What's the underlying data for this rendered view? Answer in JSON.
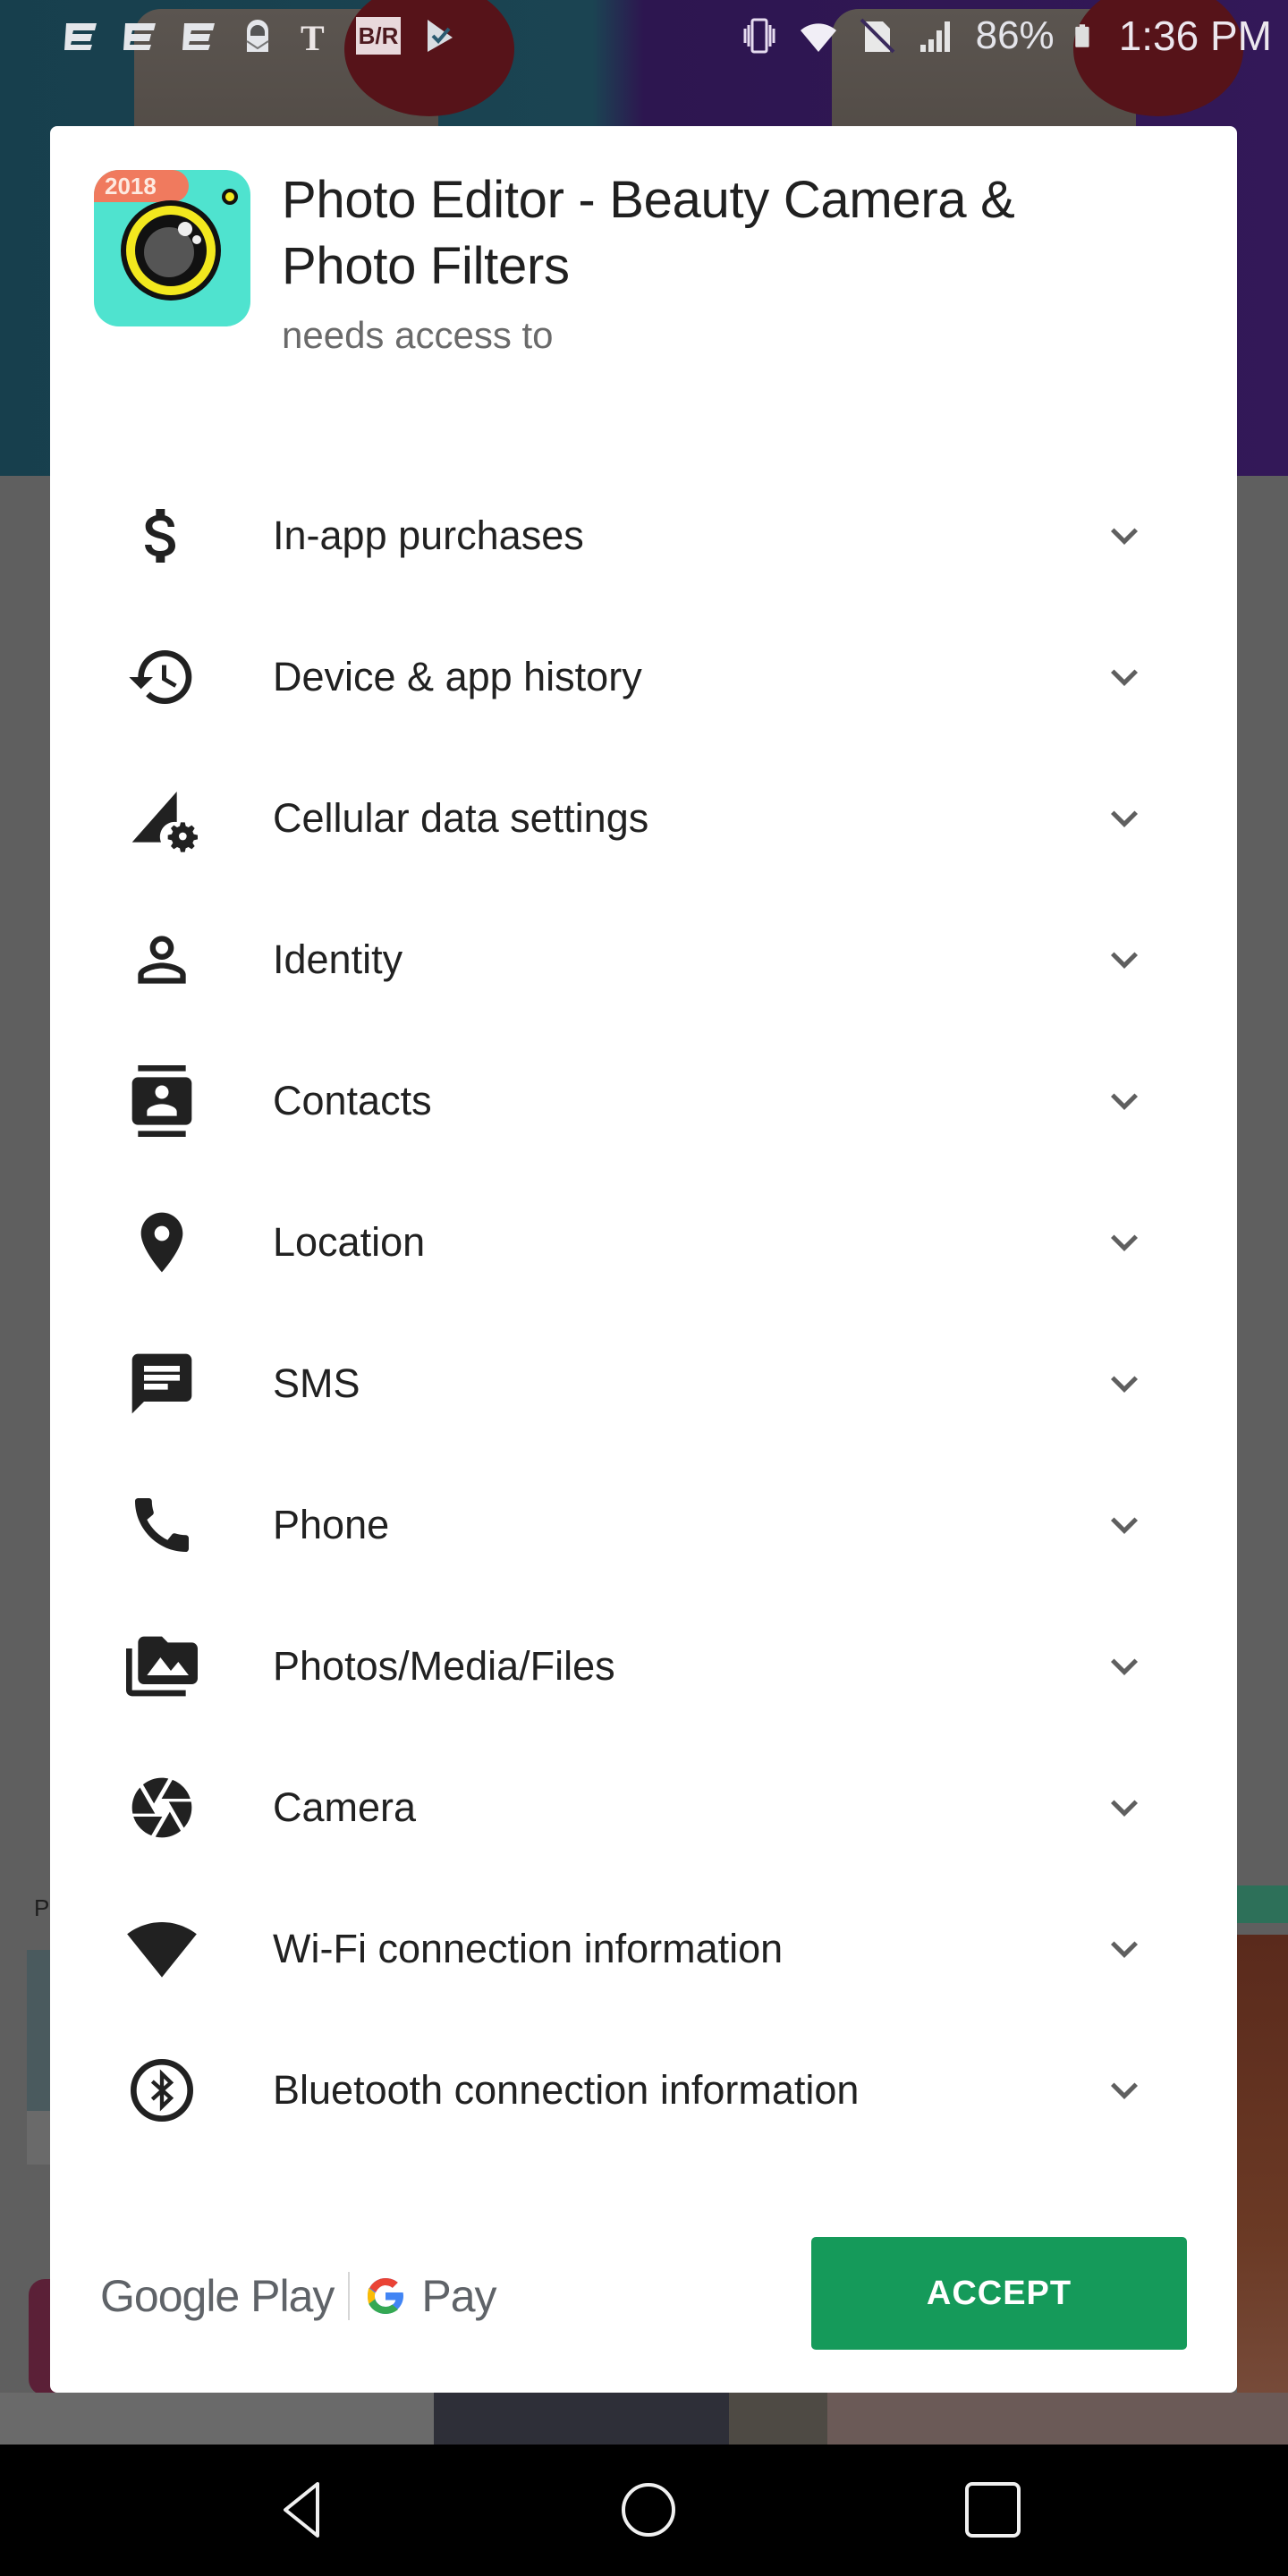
{
  "status_bar": {
    "left_icons": [
      "espn-icon",
      "espn-icon",
      "espn-icon",
      "protonmail-icon",
      "nytimes-icon",
      "bleacher-report-icon",
      "checkmark-app-icon"
    ],
    "bleacher_report_text": "B/R",
    "right_icons": [
      "vibrate-icon",
      "wifi-icon",
      "no-sim-icon",
      "signal-icon",
      "battery-icon"
    ],
    "battery": "86%",
    "time": "1:36 PM"
  },
  "background": {
    "section_label": "P"
  },
  "dialog": {
    "app_icon_badge": "2018",
    "app_title": "Photo Editor - Beauty Camera & Photo Filters",
    "subtitle": "needs access to",
    "permissions": [
      {
        "label": "In-app purchases",
        "icon": "dollar-icon"
      },
      {
        "label": "Device & app history",
        "icon": "history-icon"
      },
      {
        "label": "Cellular data settings",
        "icon": "cellular-settings-icon"
      },
      {
        "label": "Identity",
        "icon": "person-icon"
      },
      {
        "label": "Contacts",
        "icon": "contacts-icon"
      },
      {
        "label": "Location",
        "icon": "location-pin-icon"
      },
      {
        "label": "SMS",
        "icon": "message-icon"
      },
      {
        "label": "Phone",
        "icon": "phone-icon"
      },
      {
        "label": "Photos/Media/Files",
        "icon": "photo-library-icon"
      },
      {
        "label": "Camera",
        "icon": "camera-shutter-icon"
      },
      {
        "label": "Wi-Fi connection information",
        "icon": "wifi-icon"
      },
      {
        "label": "Bluetooth connection information",
        "icon": "bluetooth-icon"
      }
    ],
    "footer": {
      "brand_google_play": "Google Play",
      "brand_pay": "Pay",
      "accept_label": "ACCEPT"
    }
  },
  "colors": {
    "accept_green": "#159a5a",
    "chevron": "#5f5f5f",
    "text_primary": "#212121",
    "text_secondary": "#6a6a6a",
    "app_icon_bg": "#4fe3cf",
    "app_icon_badge": "#f07a5e"
  },
  "nav_bar": {
    "buttons": [
      "back",
      "home",
      "recents"
    ]
  }
}
